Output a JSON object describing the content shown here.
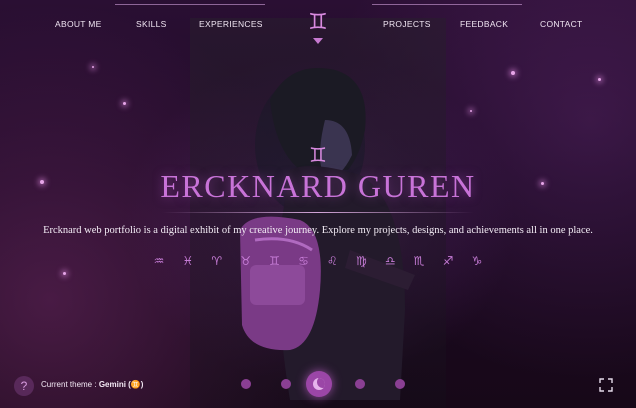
{
  "nav": {
    "left": [
      "ABOUT ME",
      "SKILLS",
      "EXPERIENCES"
    ],
    "right": [
      "PROJECTS",
      "FEEDBACK",
      "CONTACT"
    ],
    "logo": "♊"
  },
  "hero": {
    "glyph": "♊",
    "title": "ERCKNARD GUREN",
    "description": "Ercknard web portfolio is a digital exhibit of my creative journey. Explore my projects, designs, and achievements all in one place."
  },
  "zodiac": [
    "♒",
    "♓",
    "♈",
    "♉",
    "♊",
    "♋",
    "♌",
    "♍",
    "♎",
    "♏",
    "♐",
    "♑"
  ],
  "footer": {
    "help": "?",
    "theme_label": "Current theme :",
    "theme_value": "Gemini (♊)"
  },
  "colors": {
    "accent": "#c873d8",
    "background": "#1a0a1f",
    "dot": "#8a3f93"
  },
  "icons": {
    "logo": "gemini-icon",
    "help": "question-icon",
    "fullscreen": "fullscreen-icon",
    "carousel_active": "moon-icon"
  }
}
